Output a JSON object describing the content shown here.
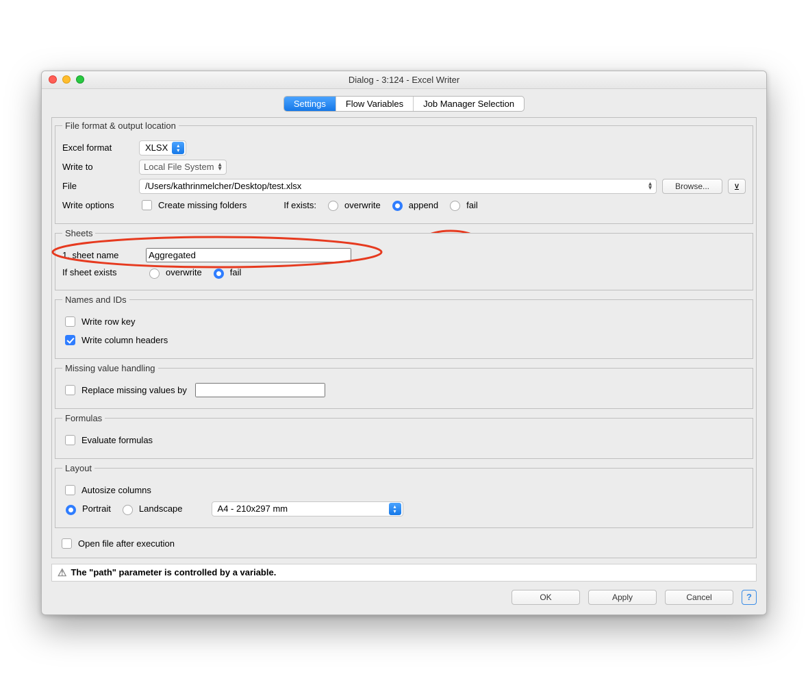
{
  "window": {
    "title": "Dialog - 3:124 - Excel Writer"
  },
  "tabs": {
    "settings": "Settings",
    "flow": "Flow Variables",
    "job": "Job Manager Selection"
  },
  "groups": {
    "file": "File format & output location",
    "sheets": "Sheets",
    "names": "Names and IDs",
    "missing": "Missing value handling",
    "formulas": "Formulas",
    "layout": "Layout"
  },
  "fileSection": {
    "excelFormatLabel": "Excel format",
    "excelFormatValue": "XLSX",
    "writeToLabel": "Write to",
    "writeToValue": "Local File System",
    "fileLabel": "File",
    "filePath": "/Users/kathrinmelcher/Desktop/test.xlsx",
    "browse": "Browse...",
    "writeOptionsLabel": "Write options",
    "createMissing": "Create missing folders",
    "ifExistsLabel": "If exists:",
    "overwrite": "overwrite",
    "append": "append",
    "fail": "fail"
  },
  "sheets": {
    "nameLabel": "1. sheet name",
    "nameValue": "Aggregated",
    "ifSheetExistsLabel": "If sheet exists",
    "overwrite": "overwrite",
    "fail": "fail"
  },
  "names": {
    "rowKey": "Write row key",
    "colHeaders": "Write column headers"
  },
  "missing": {
    "replaceLabel": "Replace missing values by"
  },
  "formulas": {
    "evaluate": "Evaluate formulas"
  },
  "layout": {
    "autosize": "Autosize columns",
    "portrait": "Portrait",
    "landscape": "Landscape",
    "paper": "A4 - 210x297 mm"
  },
  "openAfter": "Open file after execution",
  "status": "The \"path\" parameter is controlled by a variable.",
  "buttons": {
    "ok": "OK",
    "apply": "Apply",
    "cancel": "Cancel"
  }
}
